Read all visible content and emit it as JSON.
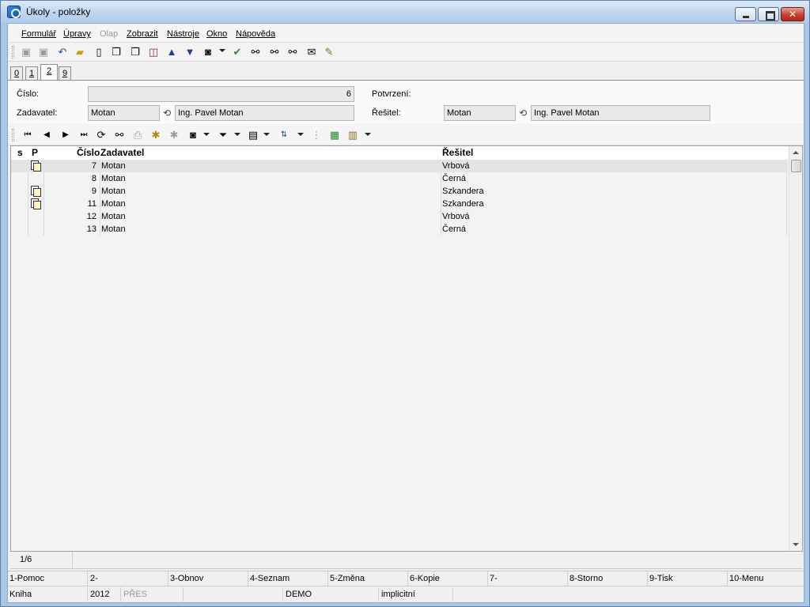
{
  "window": {
    "title": "Úkoly - položky"
  },
  "menu": {
    "items": [
      "Formulář",
      "Úpravy",
      "Olap",
      "Zobrazit",
      "Nástroje",
      "Okno",
      "Nápověda"
    ]
  },
  "tabs": [
    {
      "label": "0"
    },
    {
      "label": "1"
    },
    {
      "label": "2",
      "active": true
    },
    {
      "label": "9"
    }
  ],
  "form": {
    "cislo_label": "Číslo:",
    "cislo_value": "6",
    "potvrzeni_label": "Potvrzení:",
    "zadavatel_label": "Zadavatel:",
    "zadavatel_code": "Motan",
    "zadavatel_name": "Ing. Pavel Motan",
    "resitel_label": "Řešitel:",
    "resitel_code": "Motan",
    "resitel_name": "Ing. Pavel Motan"
  },
  "grid": {
    "columns": [
      "s",
      "P",
      "Číslo",
      "Zadavatel",
      "Řešitel"
    ],
    "rows": [
      {
        "p_icon": true,
        "cislo": "7",
        "zadavatel": "Motan",
        "resitel": "Vrbová",
        "selected": true
      },
      {
        "p_icon": false,
        "cislo": "8",
        "zadavatel": "Motan",
        "resitel": "Černá"
      },
      {
        "p_icon": true,
        "cislo": "9",
        "zadavatel": "Motan",
        "resitel": "Szkandera"
      },
      {
        "p_icon": true,
        "cislo": "11",
        "zadavatel": "Motan",
        "resitel": "Szkandera"
      },
      {
        "p_icon": false,
        "cislo": "12",
        "zadavatel": "Motan",
        "resitel": "Vrbová"
      },
      {
        "p_icon": false,
        "cislo": "13",
        "zadavatel": "Motan",
        "resitel": "Černá"
      }
    ]
  },
  "record_position": "1/6",
  "function_keys": [
    "1-Pomoc",
    "2-",
    "3-Obnov",
    "4-Seznam",
    "5-Změna",
    "6-Kopie",
    "7-",
    "8-Storno",
    "9-Tisk",
    "10-Menu"
  ],
  "infobar": {
    "kniha": "Kniha",
    "year": "2012",
    "mode": "PŘES",
    "db": "DEMO",
    "profile": "implicitní"
  }
}
